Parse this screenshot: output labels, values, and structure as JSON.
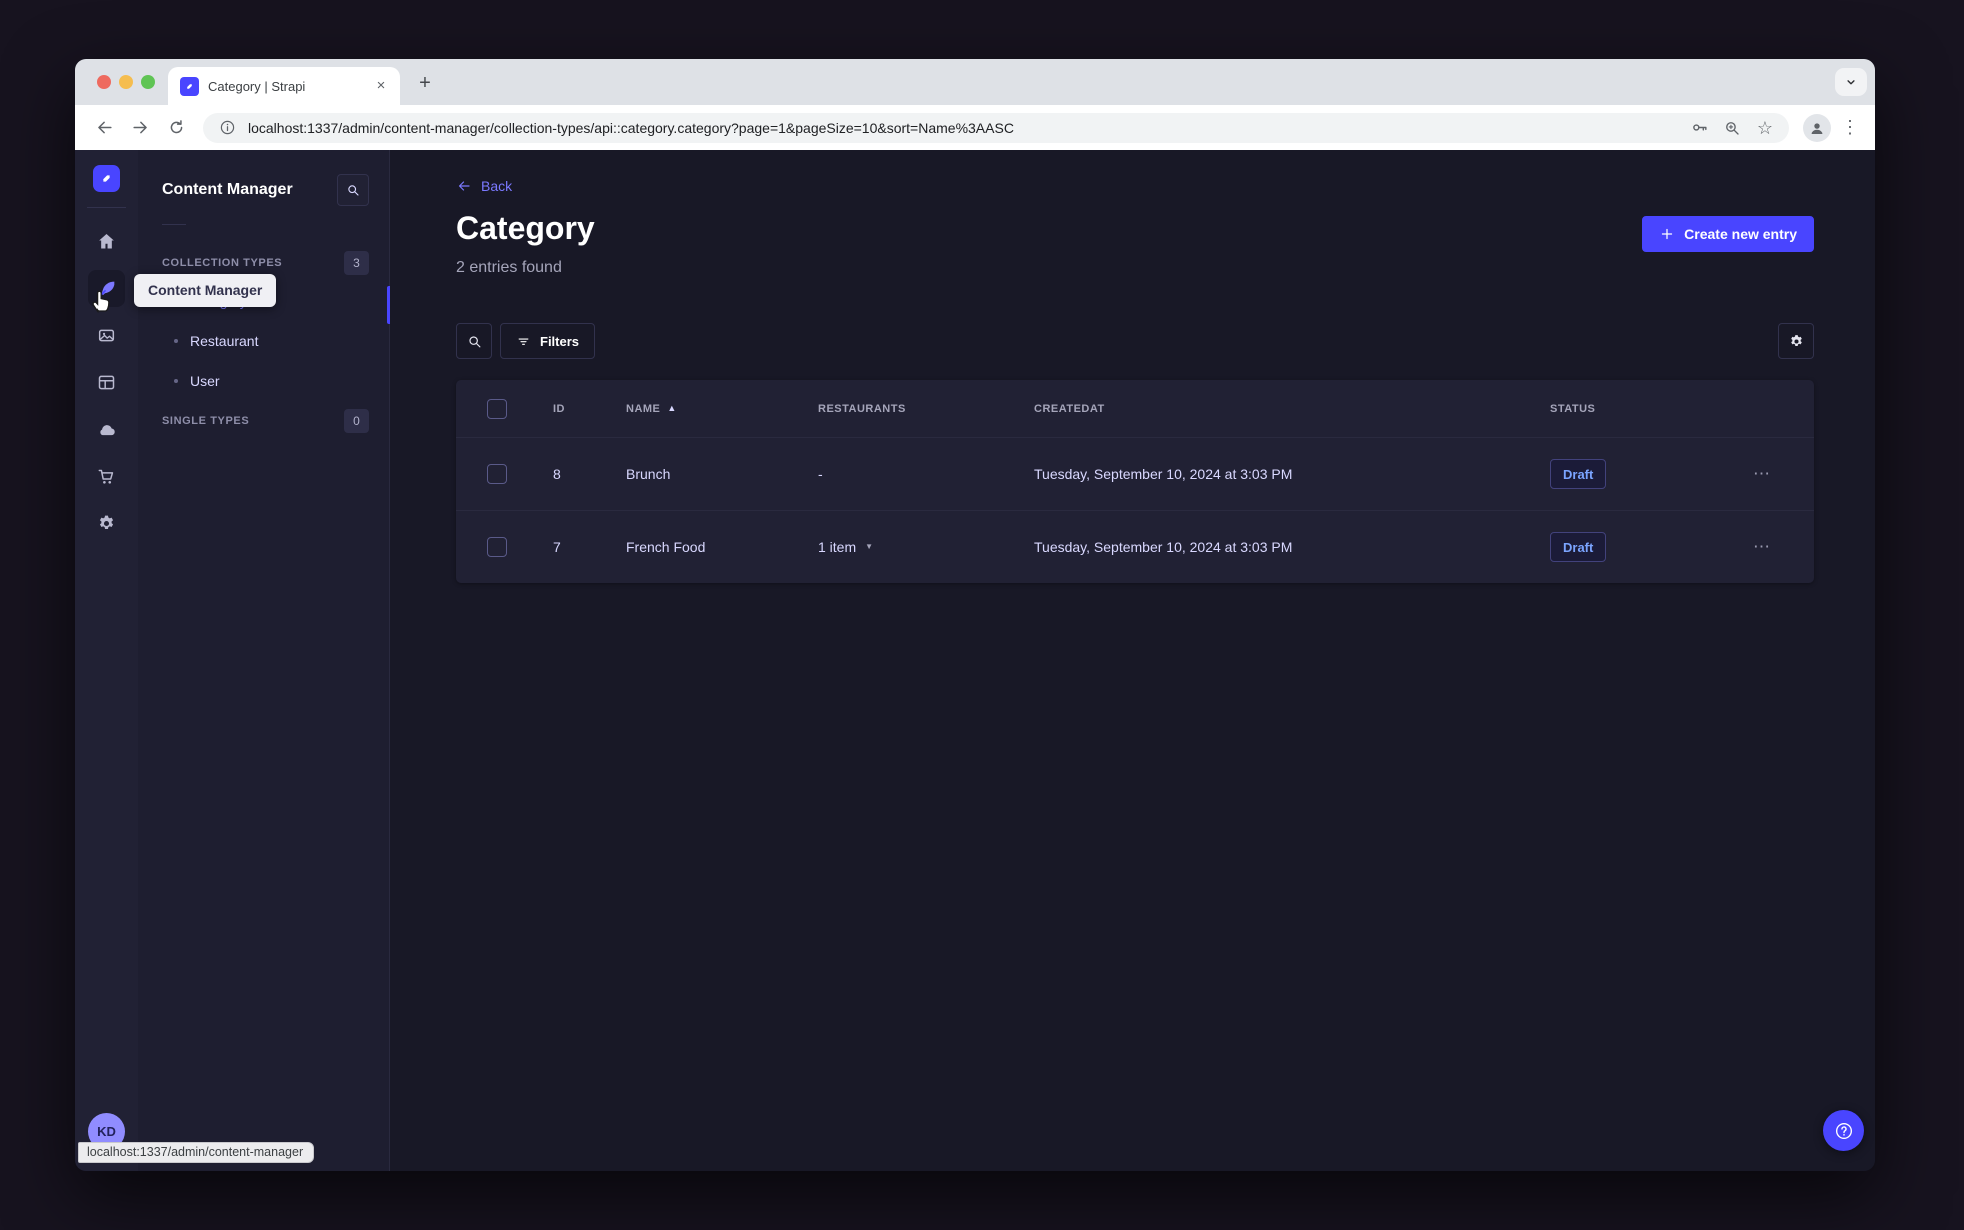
{
  "browser": {
    "tab": {
      "title": "Category | Strapi"
    },
    "url": "localhost:1337/admin/content-manager/collection-types/api::category.category?page=1&pageSize=10&sort=Name%3AASC",
    "status_bar": "localhost:1337/admin/content-manager"
  },
  "rail": {
    "tooltip": "Content Manager",
    "avatar_initials": "KD"
  },
  "subnav": {
    "title": "Content Manager",
    "sections": [
      {
        "label": "COLLECTION TYPES",
        "badge": "3",
        "items": [
          {
            "label": "Category"
          },
          {
            "label": "Restaurant"
          },
          {
            "label": "User"
          }
        ]
      },
      {
        "label": "SINGLE TYPES",
        "badge": "0",
        "items": []
      }
    ]
  },
  "main": {
    "back_label": "Back",
    "title": "Category",
    "subtitle": "2 entries found",
    "create_button": "Create new entry",
    "filters_button": "Filters",
    "table": {
      "headers": [
        "ID",
        "NAME",
        "RESTAURANTS",
        "CREATEDAT",
        "STATUS"
      ],
      "rows": [
        {
          "id": "8",
          "name": "Brunch",
          "restaurants": "-",
          "createdAt": "Tuesday, September 10, 2024 at 3:03 PM",
          "status": "Draft"
        },
        {
          "id": "7",
          "name": "French Food",
          "restaurants": "1 item",
          "createdAt": "Tuesday, September 10, 2024 at 3:03 PM",
          "status": "Draft"
        }
      ]
    }
  },
  "icons": {
    "close": "×",
    "new_tab": "+",
    "menu_dots": "⋮",
    "star": "☆",
    "sort_asc": "▲",
    "caret_down": "▼",
    "row_actions": "⋯"
  },
  "colors": {
    "accent": "#4945ff",
    "link": "#7b79ff",
    "draft_text": "#7ba4ff",
    "page_bg": "#181826",
    "surface_bg": "#212134"
  }
}
